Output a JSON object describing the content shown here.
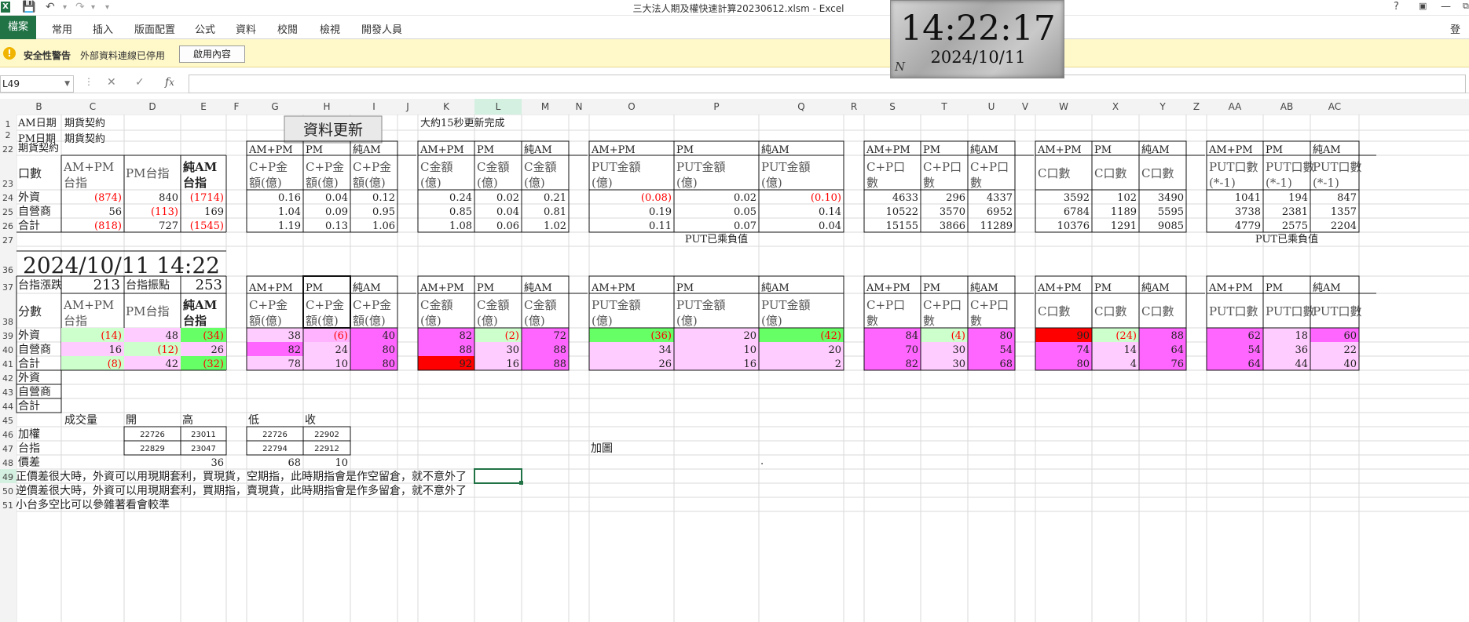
{
  "app": {
    "title": "三大法人期及權快速計算20230612.xlsm - Excel",
    "help": "?",
    "login": "登入"
  },
  "ribbon": {
    "file": "檔案",
    "tabs": [
      "常用",
      "插入",
      "版面配置",
      "公式",
      "資料",
      "校閱",
      "檢視",
      "開發人員"
    ]
  },
  "security": {
    "title": "安全性警告",
    "text": "外部資料連線已停用",
    "button": "啟用內容"
  },
  "formula_bar": {
    "name_box": "L49",
    "value": ""
  },
  "clock": {
    "time": "14:22:17",
    "date": "2024/10/11",
    "n": "N"
  },
  "columns": [
    "B",
    "C",
    "D",
    "E",
    "F",
    "G",
    "H",
    "I",
    "J",
    "K",
    "L",
    "M",
    "N",
    "O",
    "P",
    "Q",
    "R",
    "S",
    "T",
    "U",
    "V",
    "W",
    "X",
    "Y",
    "Z",
    "AA",
    "AB",
    "AC"
  ],
  "rows": [
    "1",
    "2",
    "22",
    "23",
    "24",
    "25",
    "26",
    "27",
    "36",
    "37",
    "38",
    "39",
    "40",
    "41",
    "42",
    "43",
    "44",
    "45",
    "46",
    "47",
    "48",
    "49",
    "50",
    "51"
  ],
  "top_labels": {
    "am_date": "AM日期",
    "pm_date": "PM日期",
    "futures1": "期貨契約",
    "futures2": "期貨契約",
    "futures3": "期貨契約",
    "update_button": "資料更新",
    "update_note": "大約15秒更新完成",
    "put_note": "PUT已乘負值",
    "put_note2": "PUT已乘負值"
  },
  "header_a": [
    [
      "AM+PM",
      "PM",
      "純AM"
    ],
    [
      "AM+PM",
      "PM",
      "純AM"
    ],
    [
      "AM+PM",
      "PM",
      "純AM"
    ],
    [
      "AM+PM",
      "PM",
      "純AM"
    ],
    [
      "AM+PM",
      "PM",
      "純AM"
    ],
    [
      "AM+PM",
      "PM",
      "純AM"
    ]
  ],
  "header_b": {
    "left": [
      "口數",
      "AM+PM 台指",
      "PM台指",
      "純AM 台指"
    ],
    "cp_amt": [
      "C+P金額(億)",
      "C+P金額(億)",
      "C+P金額(億)"
    ],
    "c_amt": [
      "C金額(億)",
      "C金額(億)",
      "C金額(億)"
    ],
    "put_amt": [
      "PUT金額(億)",
      "PUT金額(億)",
      "PUT金額(億)"
    ],
    "cp_cnt": [
      "C+P口數",
      "C+P口數",
      "C+P口數"
    ],
    "c_cnt": [
      "C口數",
      "C口數",
      "C口數"
    ],
    "put_cnt": [
      "PUT口數(*-1)",
      "PUT口數(*-1)",
      "PUT口數(*-1)"
    ]
  },
  "header_c": {
    "left": [
      "分數",
      "AM+PM 台指",
      "PM台指",
      "純AM 台指"
    ],
    "cp_amt": [
      "C+P金額(億)",
      "C+P金額(億)",
      "C+P金額(億)"
    ],
    "c_amt": [
      "C金額(億)",
      "C金額(億)",
      "C金額(億)"
    ],
    "put_amt": [
      "PUT金額(億)",
      "PUT金額(億)",
      "PUT金額(億)"
    ],
    "cp_cnt": [
      "C+P口數",
      "C+P口數",
      "C+P口數"
    ],
    "c_cnt": [
      "C口數",
      "C口數",
      "C口數"
    ],
    "put_cnt": [
      "PUT口數",
      "PUT口數",
      "PUT口數"
    ]
  },
  "top_table": [
    {
      "label": "外資",
      "tx": [
        "(874)",
        "840",
        "(1714)"
      ],
      "cp": [
        "0.16",
        "0.04",
        "0.12"
      ],
      "c": [
        "0.24",
        "0.02",
        "0.21"
      ],
      "put": [
        "(0.08)",
        "0.02",
        "(0.10)"
      ],
      "cpn": [
        "4633",
        "296",
        "4337"
      ],
      "cn": [
        "3592",
        "102",
        "3490"
      ],
      "pn": [
        "1041",
        "194",
        "847"
      ]
    },
    {
      "label": "自營商",
      "tx": [
        "56",
        "(113)",
        "169"
      ],
      "cp": [
        "1.04",
        "0.09",
        "0.95"
      ],
      "c": [
        "0.85",
        "0.04",
        "0.81"
      ],
      "put": [
        "0.19",
        "0.05",
        "0.14"
      ],
      "cpn": [
        "10522",
        "3570",
        "6952"
      ],
      "cn": [
        "6784",
        "1189",
        "5595"
      ],
      "pn": [
        "3738",
        "2381",
        "1357"
      ]
    },
    {
      "label": "合計",
      "tx": [
        "(818)",
        "727",
        "(1545)"
      ],
      "cp": [
        "1.19",
        "0.13",
        "1.06"
      ],
      "c": [
        "1.08",
        "0.06",
        "1.02"
      ],
      "put": [
        "0.11",
        "0.07",
        "0.04"
      ],
      "cpn": [
        "15155",
        "3866",
        "11289"
      ],
      "cn": [
        "10376",
        "1291",
        "9085"
      ],
      "pn": [
        "4779",
        "2575",
        "2204"
      ]
    }
  ],
  "datetime": "2024/10/11 14:22",
  "index_row": {
    "change_label": "台指漲跌",
    "change": "213",
    "range_label": "台指振點",
    "range": "253"
  },
  "score_table": [
    {
      "label": "外資",
      "tx": [
        "(14)",
        "48",
        "(34)"
      ],
      "cp": [
        "38",
        "(6)",
        "40"
      ],
      "c": [
        "82",
        "(2)",
        "72"
      ],
      "put": [
        "(36)",
        "20",
        "(42)"
      ],
      "cpn": [
        "84",
        "(4)",
        "80"
      ],
      "cn": [
        "90",
        "(24)",
        "88"
      ],
      "pn": [
        "62",
        "18",
        "60"
      ]
    },
    {
      "label": "自營商",
      "tx": [
        "16",
        "(12)",
        "26"
      ],
      "cp": [
        "82",
        "24",
        "80"
      ],
      "c": [
        "88",
        "30",
        "88"
      ],
      "put": [
        "34",
        "10",
        "20"
      ],
      "cpn": [
        "70",
        "30",
        "54"
      ],
      "cn": [
        "74",
        "14",
        "64"
      ],
      "pn": [
        "54",
        "36",
        "22"
      ]
    },
    {
      "label": "合計",
      "tx": [
        "(8)",
        "42",
        "(32)"
      ],
      "cp": [
        "78",
        "10",
        "80"
      ],
      "c": [
        "92",
        "16",
        "88"
      ],
      "put": [
        "26",
        "16",
        "2"
      ],
      "cpn": [
        "82",
        "30",
        "68"
      ],
      "cn": [
        "80",
        "4",
        "76"
      ],
      "pn": [
        "64",
        "44",
        "40"
      ]
    }
  ],
  "extra_rows": [
    "外資",
    "自營商",
    "合計"
  ],
  "price": {
    "h_volume": "成交量",
    "h_open": "開",
    "h_high": "高",
    "h_low": "低",
    "h_close": "收",
    "r1": "加權",
    "r2": "台指",
    "r3": "價差",
    "weighted": [
      "22726",
      "23011",
      "22726",
      "22902"
    ],
    "txf": [
      "22829",
      "23047",
      "22794",
      "22912"
    ],
    "spread": [
      "36",
      "68",
      "10"
    ]
  },
  "misc": {
    "chart_label": "加圖",
    "dot": "."
  },
  "notes": [
    "正價差很大時，外資可以用現期套利，買現貨，空期指，此時期指會是作空留倉，就不意外了",
    "逆價差很大時，外資可以用現期套利，買期指，賣現貨，此時期指會是作多留倉，就不意外了",
    "小台多空比可以參雜著看會較準"
  ],
  "colors": {
    "green": "#66ff66",
    "lightgreen": "#ccffcc",
    "pink": "#ffb3ff",
    "lightpink": "#ffccff",
    "magenta": "#ff66ff",
    "red": "#ff0000",
    "brightred": "#ff2020",
    "neg": "#ff0000",
    "excel": "#217346"
  },
  "score_colors": [
    [
      "lightgreen",
      "lightpink",
      "green",
      "lightpink",
      "pink",
      "magenta",
      "magenta",
      "lightgreen",
      "magenta",
      "green",
      "lightpink",
      "green",
      "magenta",
      "lightgreen",
      "magenta",
      "red",
      "lightgreen",
      "magenta",
      "magenta",
      "lightpink",
      "magenta"
    ],
    [
      "lightpink",
      "lightgreen",
      "lightpink",
      "magenta",
      "lightpink",
      "magenta",
      "magenta",
      "lightpink",
      "magenta",
      "lightpink",
      "lightpink",
      "lightpink",
      "magenta",
      "lightpink",
      "magenta",
      "magenta",
      "lightpink",
      "magenta",
      "magenta",
      "lightpink",
      "lightpink"
    ],
    [
      "lightgreen",
      "lightpink",
      "green",
      "lightpink",
      "lightpink",
      "magenta",
      "red",
      "lightpink",
      "magenta",
      "lightpink",
      "lightpink",
      "lightpink",
      "magenta",
      "lightpink",
      "magenta",
      "magenta",
      "lightpink",
      "magenta",
      "magenta",
      "lightpink",
      "lightpink"
    ]
  ]
}
